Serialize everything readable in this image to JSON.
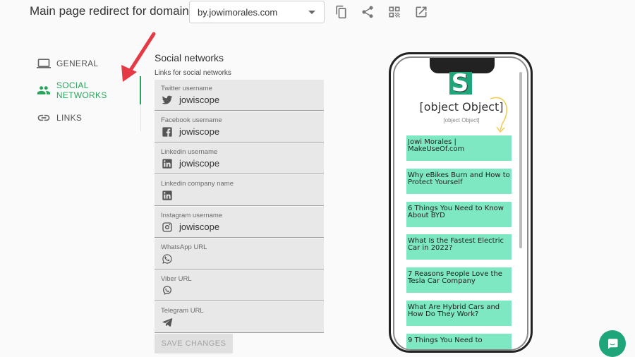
{
  "header": {
    "title": "Main page redirect for domain",
    "domain_value": "by.jowimorales.com",
    "icons": [
      "copy-icon",
      "share-icon",
      "qr-code-icon",
      "open-external-icon"
    ]
  },
  "nav": {
    "items": [
      {
        "label": "GENERAL",
        "icon": "laptop-icon"
      },
      {
        "label": "SOCIAL NETWORKS",
        "icon": "people-icon"
      },
      {
        "label": "LINKS",
        "icon": "link-icon"
      }
    ],
    "active_color": "#26a65b"
  },
  "form": {
    "section_title": "Social networks",
    "section_subtitle": "Links for social networks",
    "fields": [
      {
        "label": "Twitter username",
        "value": "jowiscope",
        "icon": "twitter-icon"
      },
      {
        "label": "Facebook username",
        "value": "jowiscope",
        "icon": "facebook-icon"
      },
      {
        "label": "Linkedin username",
        "value": "jowiscope",
        "icon": "linkedin-icon"
      },
      {
        "label": "Linkedin company name",
        "value": "",
        "icon": "linkedin-icon"
      },
      {
        "label": "Instagram username",
        "value": "jowiscope",
        "icon": "instagram-icon"
      },
      {
        "label": "WhatsApp URL",
        "value": "",
        "icon": "whatsapp-icon"
      },
      {
        "label": "Viber URL",
        "value": "",
        "icon": "viber-icon"
      },
      {
        "label": "Telegram URL",
        "value": "",
        "icon": "telegram-icon"
      }
    ],
    "save_label": "SAVE CHANGES"
  },
  "preview": {
    "logo_letter": "S",
    "title": "[object Object]",
    "subtitle": "[object Object]",
    "links": [
      "Jowi Morales | MakeUseOf.com",
      "Why eBikes Burn and How to Protect Yourself",
      "6 Things You Need to Know About BYD",
      "What Is the Fastest Electric Car in 2022?",
      "7 Reasons People Love the Tesla Car Company",
      "What Are Hybrid Cars and How Do They Work?",
      "9 Things You Need to"
    ],
    "link_color": "#7de8c1",
    "brand_color": "#1fa57a"
  }
}
